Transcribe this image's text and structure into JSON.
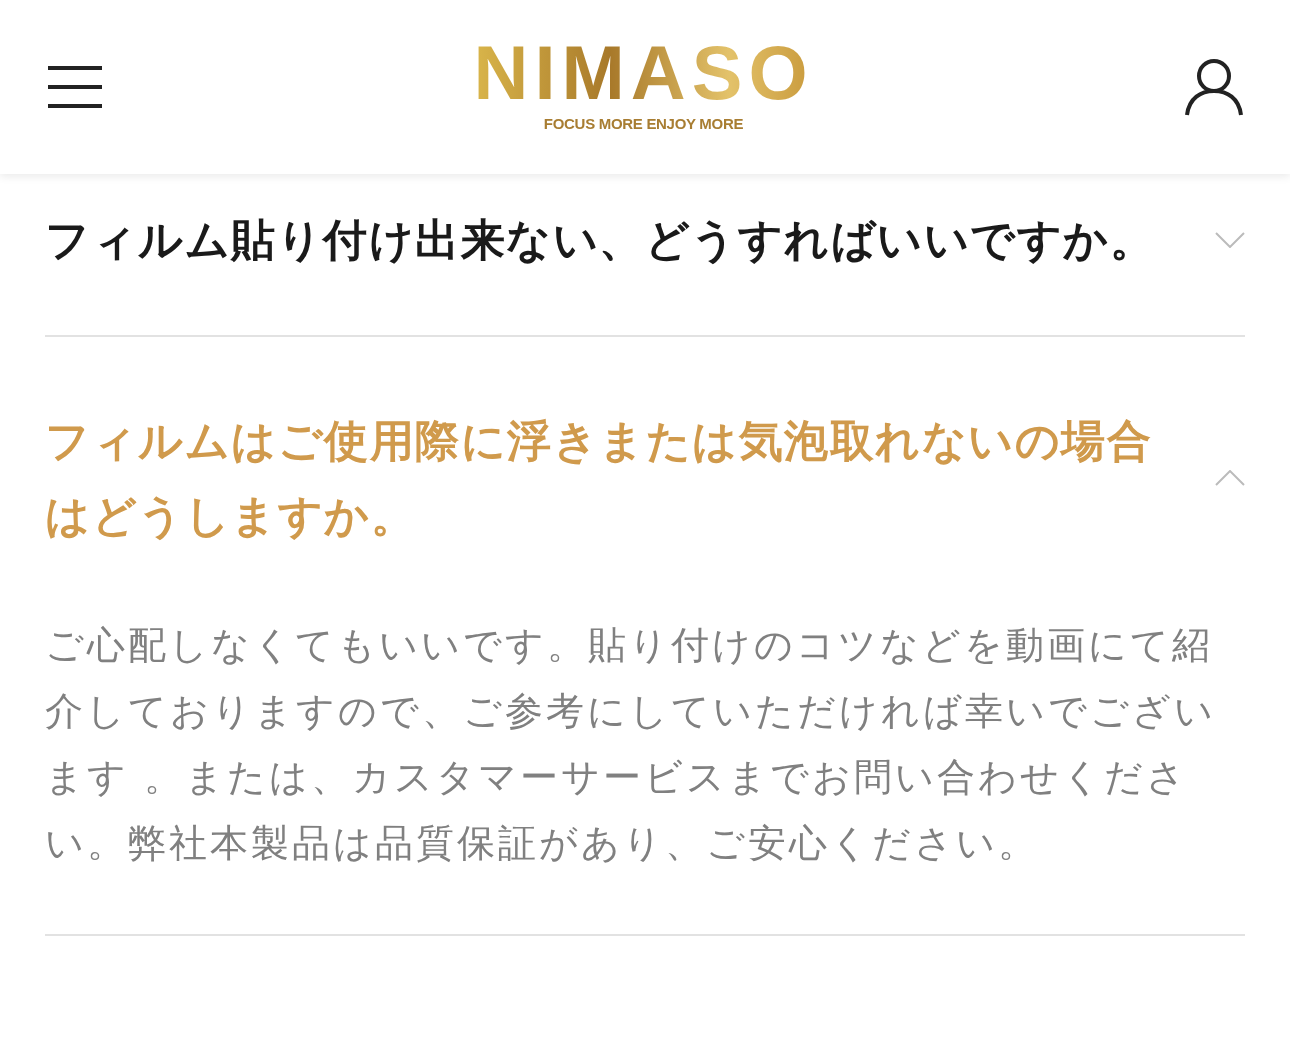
{
  "header": {
    "logo": {
      "name": "NIMASO",
      "tagline": "FOCUS MORE ENJOY MORE"
    }
  },
  "faq": [
    {
      "question": "フィルム貼り付け出来ない、どうすればいいですか。",
      "expanded": false
    },
    {
      "question": "フィルムはご使用際に浮きまたは気泡取れないの場合はどうしますか。",
      "expanded": true,
      "answer": "ご心配しなくてもいいです。貼り付けのコツなどを動画にて紹介しておりますので、ご参考にしていただければ幸いでございます 。または、カスタマーサービスまでお問い合わせください。弊社本製品は品質保証があり、ご安心ください。"
    }
  ]
}
